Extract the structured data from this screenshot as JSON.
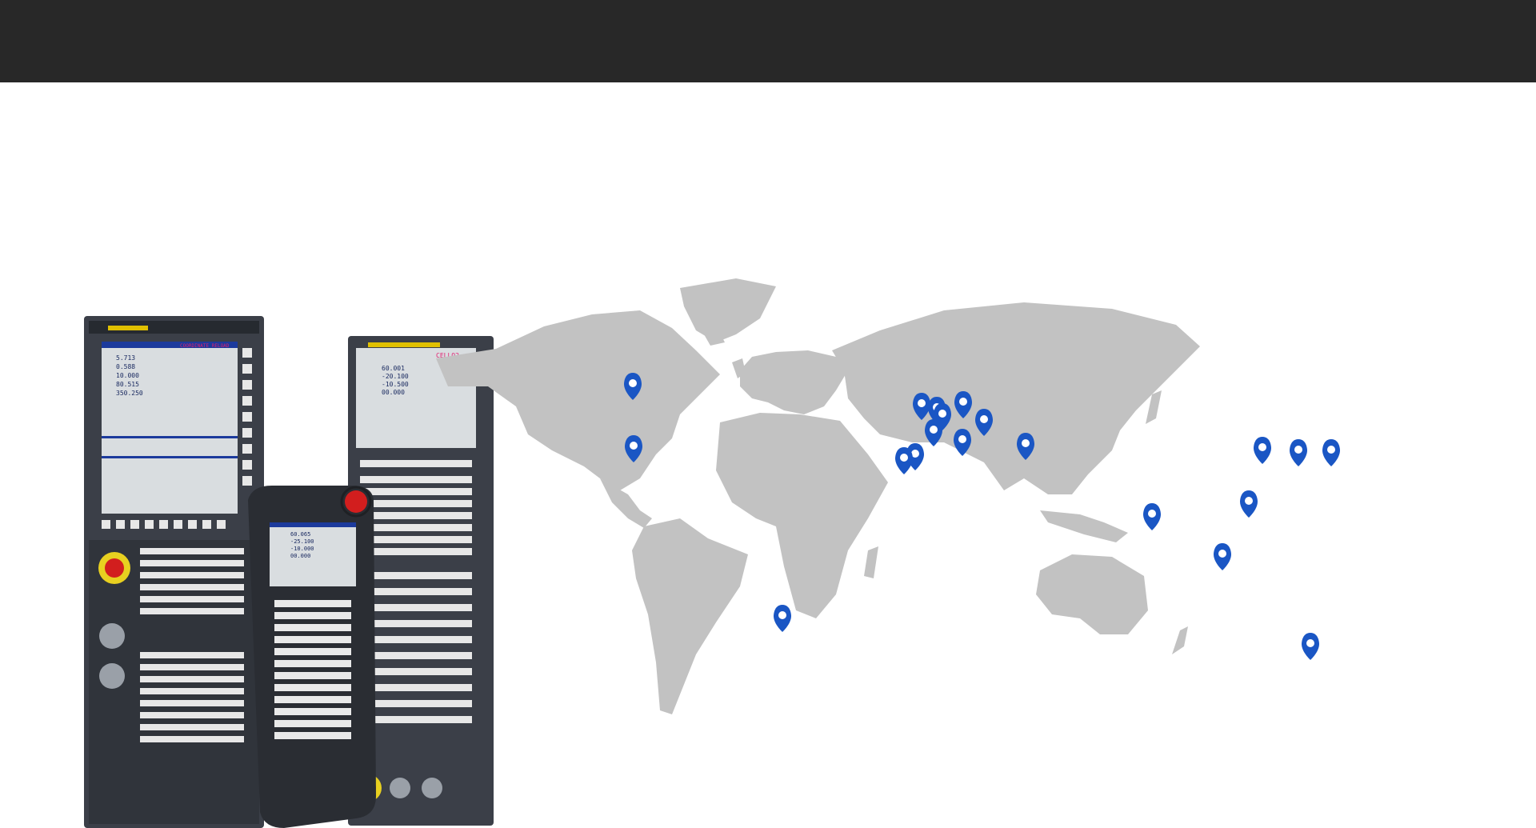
{
  "header": {
    "background": "#282828"
  },
  "colors": {
    "map_land": "#c2c2c2",
    "pin": "#1a56c4",
    "panel": "#3b3f48"
  },
  "cnc_illustration": {
    "left_screen_label": "COORDINATE RELOAD",
    "right_screen_label": "CELLO2",
    "readout_left": [
      "5.713",
      "0.588",
      "10.000",
      "80.515",
      "350.250"
    ],
    "readout_right": [
      "60.001",
      "-20.100",
      "-10.500",
      "00.000"
    ],
    "pendant_readout": [
      "60.065",
      "-25.100",
      "-10.000",
      "00.000"
    ]
  },
  "map_pins": [
    {
      "region": "Canada"
    },
    {
      "region": "United States"
    },
    {
      "region": "Brazil"
    },
    {
      "region": "United Kingdom"
    },
    {
      "region": "Spain"
    },
    {
      "region": "Portugal"
    },
    {
      "region": "France"
    },
    {
      "region": "Belgium"
    },
    {
      "region": "Netherlands"
    },
    {
      "region": "Germany"
    },
    {
      "region": "Poland"
    },
    {
      "region": "Italy"
    },
    {
      "region": "Turkey"
    },
    {
      "region": "India"
    },
    {
      "region": "China North"
    },
    {
      "region": "Korea"
    },
    {
      "region": "Japan"
    },
    {
      "region": "China South"
    },
    {
      "region": "Singapore"
    },
    {
      "region": "Australia"
    }
  ]
}
